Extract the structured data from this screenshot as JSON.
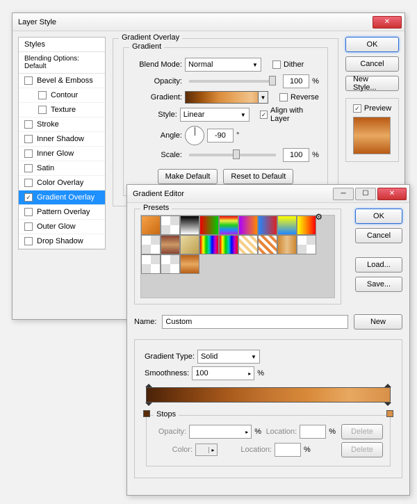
{
  "layerStyle": {
    "title": "Layer Style",
    "stylesHeader": "Styles",
    "blendingOptions": "Blending Options: Default",
    "items": [
      {
        "label": "Bevel & Emboss",
        "checked": false,
        "indent": false
      },
      {
        "label": "Contour",
        "checked": false,
        "indent": true
      },
      {
        "label": "Texture",
        "checked": false,
        "indent": true
      },
      {
        "label": "Stroke",
        "checked": false,
        "indent": false
      },
      {
        "label": "Inner Shadow",
        "checked": false,
        "indent": false
      },
      {
        "label": "Inner Glow",
        "checked": false,
        "indent": false
      },
      {
        "label": "Satin",
        "checked": false,
        "indent": false
      },
      {
        "label": "Color Overlay",
        "checked": false,
        "indent": false
      },
      {
        "label": "Gradient Overlay",
        "checked": true,
        "indent": false,
        "selected": true
      },
      {
        "label": "Pattern Overlay",
        "checked": false,
        "indent": false
      },
      {
        "label": "Outer Glow",
        "checked": false,
        "indent": false
      },
      {
        "label": "Drop Shadow",
        "checked": false,
        "indent": false
      }
    ],
    "section": {
      "title": "Gradient Overlay",
      "subTitle": "Gradient",
      "blendModeLabel": "Blend Mode:",
      "blendMode": "Normal",
      "dither": "Dither",
      "opacityLabel": "Opacity:",
      "opacity": "100",
      "pct": "%",
      "gradientLabel": "Gradient:",
      "reverse": "Reverse",
      "styleLabel": "Style:",
      "style": "Linear",
      "align": "Align with Layer",
      "angleLabel": "Angle:",
      "angle": "-90",
      "deg": "°",
      "scaleLabel": "Scale:",
      "scale": "100",
      "makeDefault": "Make Default",
      "resetDefault": "Reset to Default"
    },
    "buttons": {
      "ok": "OK",
      "cancel": "Cancel",
      "newStyle": "New Style...",
      "preview": "Preview"
    }
  },
  "gradientEditor": {
    "title": "Gradient Editor",
    "presetsLabel": "Presets",
    "buttons": {
      "ok": "OK",
      "cancel": "Cancel",
      "load": "Load...",
      "save": "Save...",
      "new": "New",
      "delete": "Delete"
    },
    "nameLabel": "Name:",
    "name": "Custom",
    "gradTypeLabel": "Gradient Type:",
    "gradType": "Solid",
    "smoothLabel": "Smoothness:",
    "smooth": "100",
    "pct": "%",
    "stopsLabel": "Stops",
    "opacityLabel": "Opacity:",
    "locationLabel": "Location:",
    "colorLabel": "Color:",
    "presets": [
      "linear-gradient(135deg,#f7a146,#c96a12)",
      "repeating-conic-gradient(#ddd 0 25%,#fff 0 50%)",
      "linear-gradient(#000,#fff)",
      "linear-gradient(to right,#e00,#0c0)",
      "linear-gradient(#e00,#ee4,#2c2,#28f,#a2e)",
      "linear-gradient(to right,#a0f,#f80)",
      "linear-gradient(to right,#28f,#d22)",
      "linear-gradient(#ff0,#28f)",
      "linear-gradient(to right,#ff0,#f80,#f00)",
      "repeating-conic-gradient(#ddd 0 25%,#fff 0 50%)",
      "linear-gradient(#843,#c96,#843)",
      "linear-gradient(135deg,#e8d8a0,#bfa050)",
      "linear-gradient(to right,#e00,#ff0,#0c0,#0cc,#00f,#c0c,#e00)",
      "linear-gradient(to right,#e00,#ff0,#0c0,#0cc,#00f,#c0c,#e00)",
      "repeating-linear-gradient(45deg,#fff 0 4px,#f5d08a 0 8px)",
      "repeating-linear-gradient(45deg,#fff 0 4px,#e8863a 0 8px)",
      "linear-gradient(to right,#d08830,#e8c088 50%,#d08830)",
      "repeating-conic-gradient(#ddd 0 25%,#fff 0 50%)",
      "repeating-conic-gradient(#ddd 0 25%,#fff 0 50%)",
      "repeating-conic-gradient(#ddd 0 25%,#fff 0 50%)",
      "linear-gradient(#b86018,#e8a860,#b86018)"
    ]
  }
}
